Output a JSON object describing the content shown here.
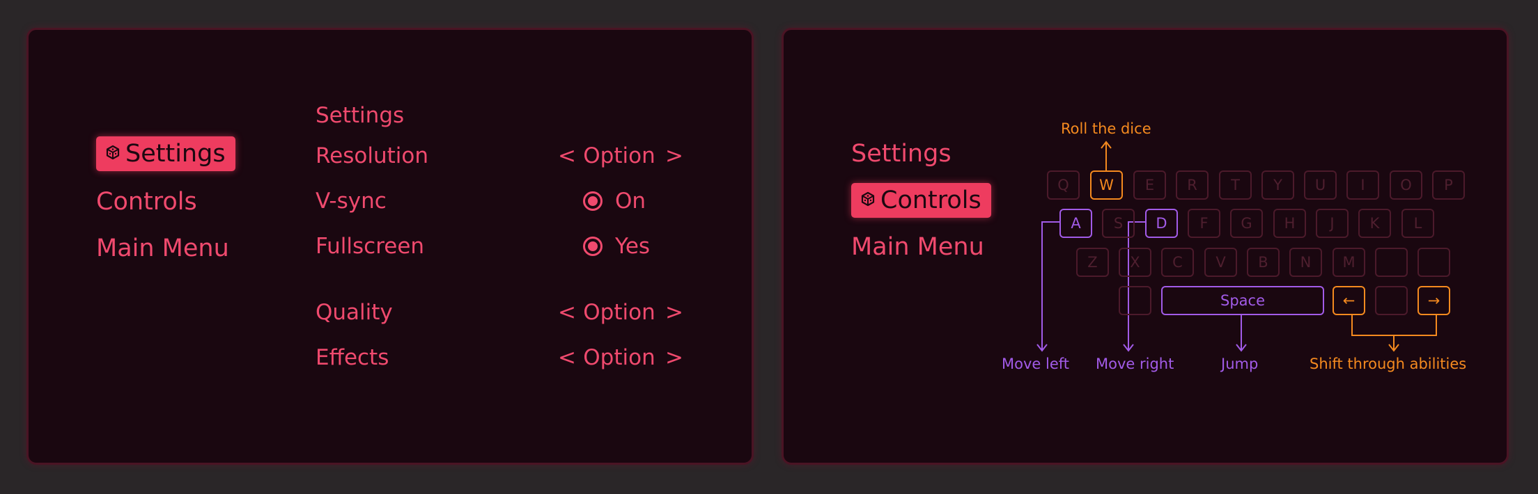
{
  "left_panel": {
    "menu": [
      {
        "label": "Settings",
        "active": true,
        "icon": "dice-icon"
      },
      {
        "label": "Controls",
        "active": false
      },
      {
        "label": "Main Menu",
        "active": false
      }
    ],
    "section_title": "Settings",
    "rows": {
      "resolution": {
        "label": "Resolution",
        "value": "Option"
      },
      "vsync": {
        "label": "V-sync",
        "value": "On"
      },
      "fullscreen": {
        "label": "Fullscreen",
        "value": "Yes"
      },
      "quality": {
        "label": "Quality",
        "value": "Option"
      },
      "effects": {
        "label": "Effects",
        "value": "Option"
      }
    },
    "arrow_left": "<",
    "arrow_right": ">"
  },
  "right_panel": {
    "menu": [
      {
        "label": "Settings",
        "active": false
      },
      {
        "label": "Controls",
        "active": true,
        "icon": "dice-icon"
      },
      {
        "label": "Main Menu",
        "active": false
      }
    ],
    "keyboard": {
      "row1": [
        "Q",
        "W",
        "E",
        "R",
        "T",
        "Y",
        "U",
        "I",
        "O",
        "P"
      ],
      "row2": [
        "A",
        "S",
        "D",
        "F",
        "G",
        "H",
        "J",
        "K",
        "L"
      ],
      "row3": [
        "Z",
        "X",
        "C",
        "V",
        "B",
        "N",
        "M",
        "",
        ""
      ],
      "row4": {
        "blank_left": "",
        "space": "Space",
        "arrow_left": "←",
        "blank_mid": "",
        "arrow_right": "→"
      }
    },
    "annotations": {
      "roll_dice": "Roll the dice",
      "move_left": "Move left",
      "move_right": "Move right",
      "jump": "Jump",
      "shift_abilities": "Shift through abilities"
    }
  },
  "colors": {
    "background": "#2a2628",
    "panel": "#1a0710",
    "panel_border": "#4a1424",
    "accent_pink": "#ee3c5f",
    "text_pink": "#f04a6e",
    "orange": "#f58a1f",
    "purple": "#a25be8",
    "key_inactive": "#4c1a2b"
  }
}
